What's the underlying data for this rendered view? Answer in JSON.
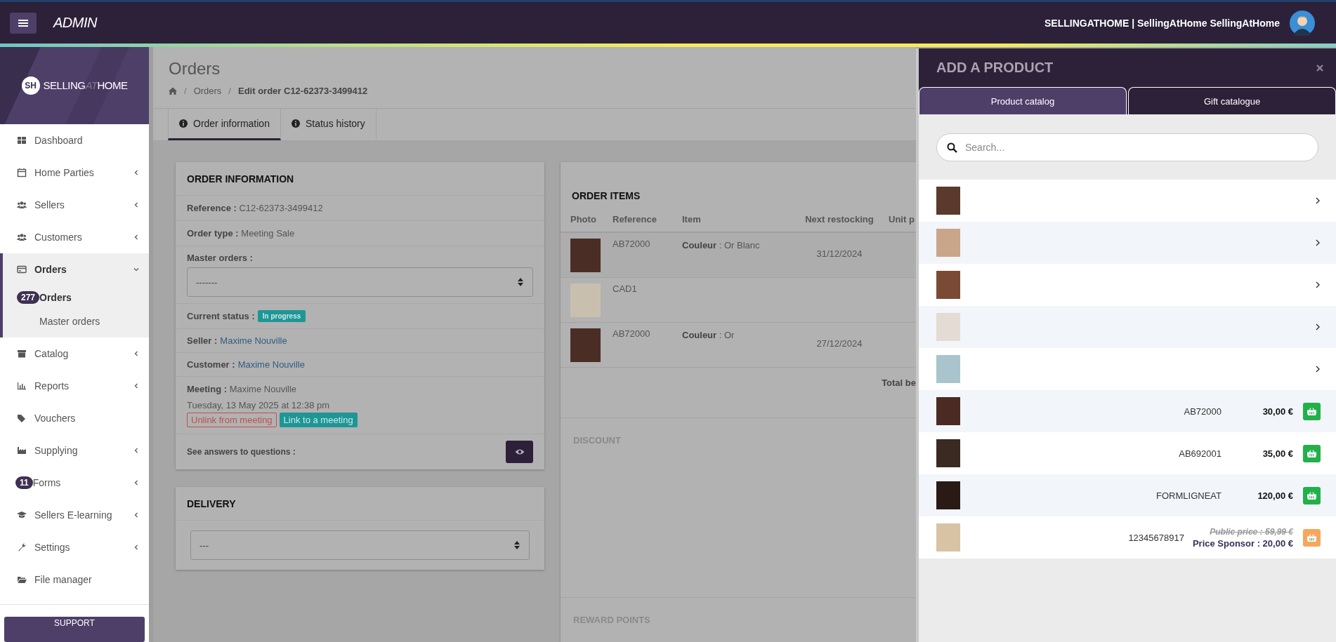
{
  "topbar": {
    "brand": "ADMIN",
    "user": "SELLINGATHOME | SellingAtHome SellingAtHome"
  },
  "sidebar": {
    "logo": {
      "mark": "SH",
      "before": "SELLING",
      "accent": "AT",
      "after": "HOME"
    },
    "items": [
      {
        "label": "Dashboard",
        "selected": false
      },
      {
        "label": "Home Parties",
        "expanded": false,
        "selected": false
      },
      {
        "label": "Sellers",
        "expanded": false,
        "selected": false
      },
      {
        "label": "Customers",
        "expanded": false,
        "selected": false
      },
      {
        "label": "Orders",
        "expanded": true,
        "selected": true,
        "children": [
          {
            "label": "Orders",
            "badge": "277",
            "selected": true
          },
          {
            "label": "Master orders",
            "selected": false
          }
        ]
      },
      {
        "label": "Catalog",
        "expanded": false,
        "selected": false
      },
      {
        "label": "Reports",
        "expanded": false,
        "selected": false
      },
      {
        "label": "Vouchers",
        "selected": false
      },
      {
        "label": "Supplying",
        "expanded": false,
        "selected": false
      },
      {
        "label": "Forms",
        "badge": "11",
        "expanded": false,
        "selected": false
      },
      {
        "label": "Sellers E-learning",
        "expanded": false,
        "selected": false
      },
      {
        "label": "Settings",
        "expanded": false,
        "selected": false
      },
      {
        "label": "File manager",
        "selected": false
      }
    ],
    "support": "SUPPORT"
  },
  "page": {
    "title": "Orders",
    "breadcrumb": [
      {
        "label": "Orders",
        "current": false
      },
      {
        "label": "Edit order C12-62373-3499412",
        "current": true
      }
    ],
    "separator": "/",
    "tabs": [
      {
        "label": "Order information",
        "selected": true
      },
      {
        "label": "Status history",
        "selected": false
      }
    ]
  },
  "order_info": {
    "title": "ORDER INFORMATION",
    "fields": [
      {
        "kind": "text",
        "text": "**Reference :** C12-62373-3499412"
      },
      {
        "kind": "text",
        "text": "**Order type :** Meeting Sale"
      },
      {
        "kind": "select",
        "label": "Master orders :",
        "value": "-------"
      },
      {
        "kind": "badge",
        "label": "Current status :",
        "value": "In progress"
      },
      {
        "kind": "link",
        "label": "Seller :",
        "value": "Maxime Nouville"
      },
      {
        "kind": "link",
        "label": "Customer :",
        "value": "Maxime Nouville"
      },
      {
        "kind": "meeting",
        "text": "**Meeting :** Maxime Nouville",
        "date": "Tuesday, 13 May 2025 at 12:38 pm",
        "unlink": "Unlink from meeting",
        "link": "Link to a meeting"
      },
      {
        "kind": "answers",
        "label": "See answers to questions :"
      }
    ]
  },
  "delivery": {
    "title": "DELIVERY",
    "value": "---"
  },
  "order_items": {
    "title": "ORDER ITEMS",
    "columns": [
      "Photo",
      "Reference",
      "Item",
      "Next restocking",
      "Unit p"
    ],
    "rows": [
      {
        "reference": "AB72000",
        "item": "**Couleur** : Or Blanc",
        "restocking": "31/12/2024"
      },
      {
        "reference": "CAD1"
      },
      {
        "reference": "AB72000",
        "item": "**Couleur** : Or",
        "restocking": "27/12/2024"
      }
    ],
    "total_label": "Total be",
    "sections": [
      "DISCOUNT",
      "REWARD POINTS"
    ]
  },
  "panel": {
    "title": "ADD A PRODUCT",
    "tabs": [
      {
        "label": "Product catalog",
        "selected": true
      },
      {
        "label": "Gift catalogue",
        "selected": false
      }
    ],
    "search": {
      "placeholder": "Search..."
    },
    "rows": [
      {
        "kind": "category"
      },
      {
        "kind": "category"
      },
      {
        "kind": "category"
      },
      {
        "kind": "category"
      },
      {
        "kind": "category"
      },
      {
        "kind": "product",
        "reference": "AB72000",
        "price": "30,00 €"
      },
      {
        "kind": "product",
        "reference": "AB692001",
        "price": "35,00 €"
      },
      {
        "kind": "product",
        "reference": "FORMLIGNEAT",
        "price": "120,00 €"
      },
      {
        "kind": "sponsor",
        "reference": "12345678917",
        "public_price": "Public price : 59,99 €",
        "price": "Price Sponsor : 20,00 €"
      }
    ]
  }
}
